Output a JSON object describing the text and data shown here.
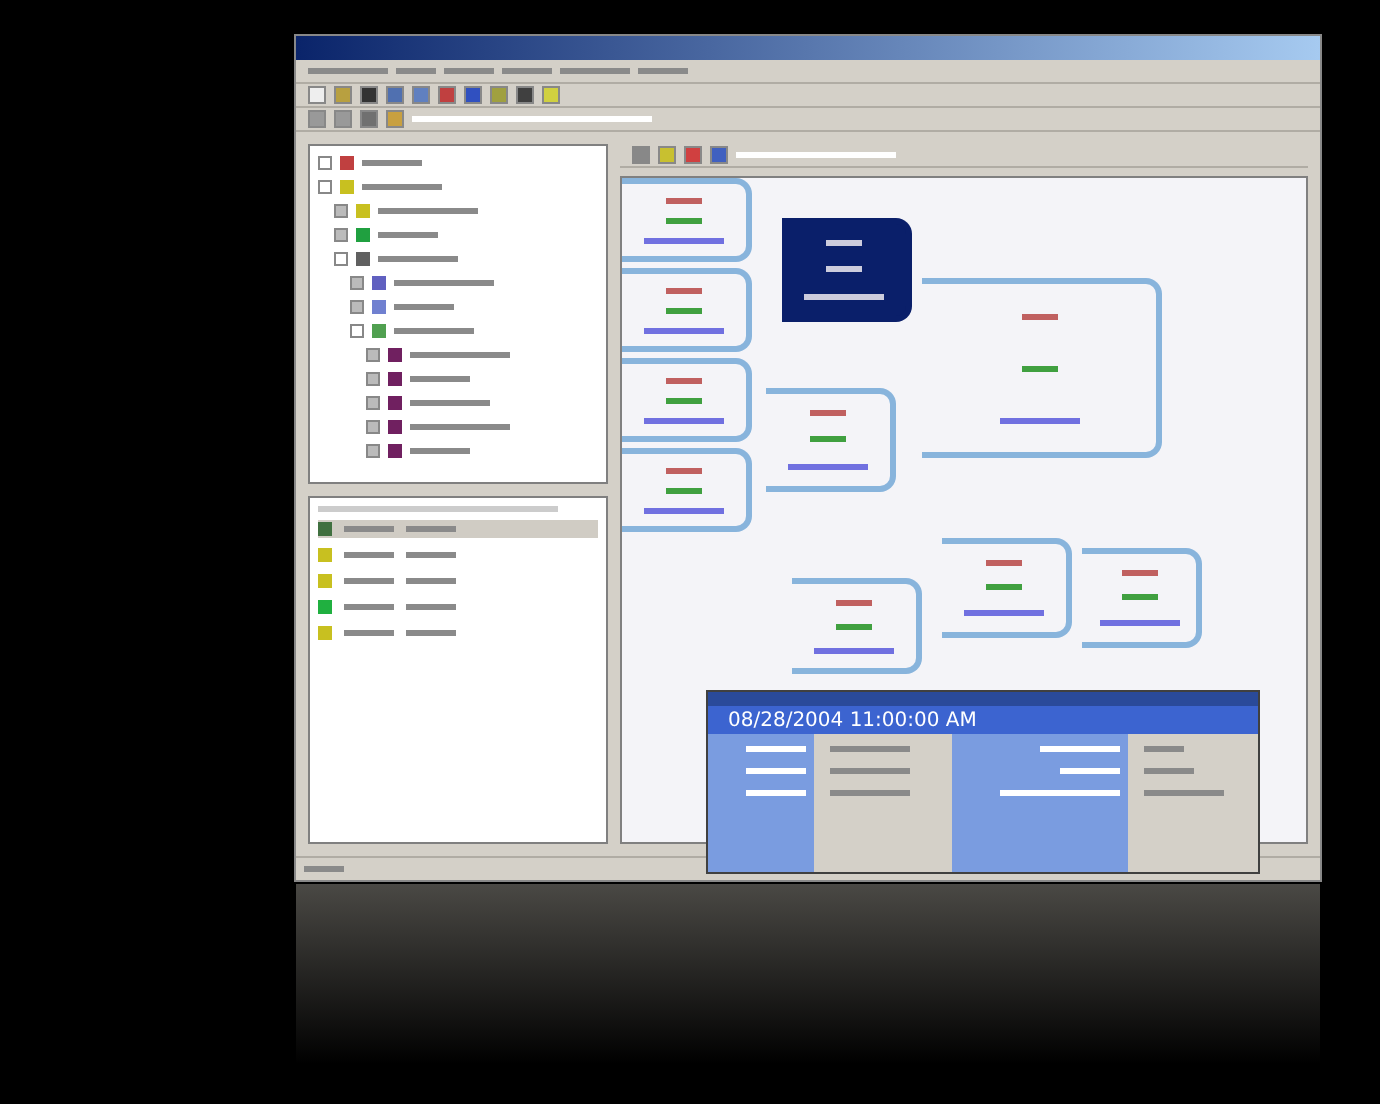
{
  "tree": {
    "items": [
      {
        "color": "#c04040",
        "expanded": true
      },
      {
        "color": "#c8c020",
        "expanded": true
      },
      {
        "color": "#c8c020",
        "expanded": false
      },
      {
        "color": "#20a040",
        "expanded": false
      },
      {
        "color": "#606060",
        "expanded": true
      },
      {
        "color": "#6060c0",
        "expanded": false
      },
      {
        "color": "#7080d0",
        "expanded": false
      },
      {
        "color": "#50a050",
        "expanded": true
      },
      {
        "color": "#702060",
        "expanded": false
      },
      {
        "color": "#702060",
        "expanded": false
      },
      {
        "color": "#702060",
        "expanded": false
      },
      {
        "color": "#702060",
        "expanded": false
      },
      {
        "color": "#702060",
        "expanded": false
      }
    ]
  },
  "list": {
    "rows": [
      {
        "color": "#407040",
        "selected": true
      },
      {
        "color": "#c8c020",
        "selected": false
      },
      {
        "color": "#c8c020",
        "selected": false
      },
      {
        "color": "#20b040",
        "selected": false
      },
      {
        "color": "#c8c020",
        "selected": false
      }
    ]
  },
  "bracket": {
    "matches": [
      {
        "selected": false
      },
      {
        "selected": false
      },
      {
        "selected": false
      },
      {
        "selected": false
      },
      {
        "selected": true
      },
      {
        "selected": false
      },
      {
        "selected": false
      },
      {
        "selected": false
      },
      {
        "selected": false
      },
      {
        "selected": false
      }
    ]
  },
  "popup": {
    "title": "08/28/2004 11:00:00 AM"
  }
}
